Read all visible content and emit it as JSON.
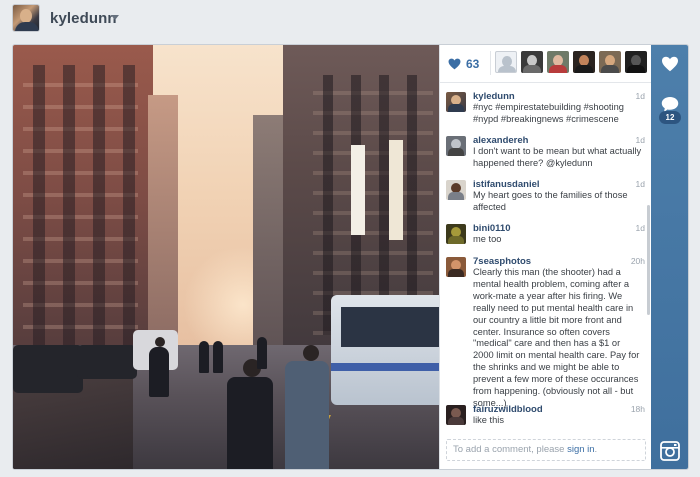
{
  "header": {
    "username": "kyledunn"
  },
  "post": {
    "like_count": "63",
    "comment_count": "12",
    "add_comment_prefix": "To add a comment, please ",
    "add_comment_link": "sign in",
    "add_comment_suffix": "."
  },
  "comments": [
    {
      "user": "kyledunn",
      "time": "1d",
      "text": "#nyc #empirestatebuilding #shooting #nypd #breakingnews #crimescene"
    },
    {
      "user": "alexandereh",
      "time": "1d",
      "text": "I don't want to be mean but what actually happened there? @kyledunn"
    },
    {
      "user": "istifanusdaniel",
      "time": "1d",
      "text": "My heart goes to the families of those affected"
    },
    {
      "user": "bini0110",
      "time": "1d",
      "text": "me too"
    },
    {
      "user": "7seasphotos",
      "time": "20h",
      "text": "Clearly this man (the shooter) had a mental health problem, coming after a work-mate a year after his firing. We really need to put mental health care in our country a little bit more front and center. Insurance so often covers \"medical\" care and then has a $1 or 2000 limit on mental health care. Pay for the shrinks and we might be able to prevent a few more of these occurances from happening. (obviously not all - but some...)"
    },
    {
      "user": "fairuzwildblood",
      "time": "18h",
      "text": "like this"
    }
  ],
  "colors": {
    "accent": "#3b6ea5",
    "rail": "#4d7fab",
    "username": "#2f4b6e"
  },
  "icons": {
    "heart": "heart-icon",
    "comment": "comment-bubble-icon",
    "instagram": "instagram-icon",
    "caret": "chevron-down-icon"
  }
}
